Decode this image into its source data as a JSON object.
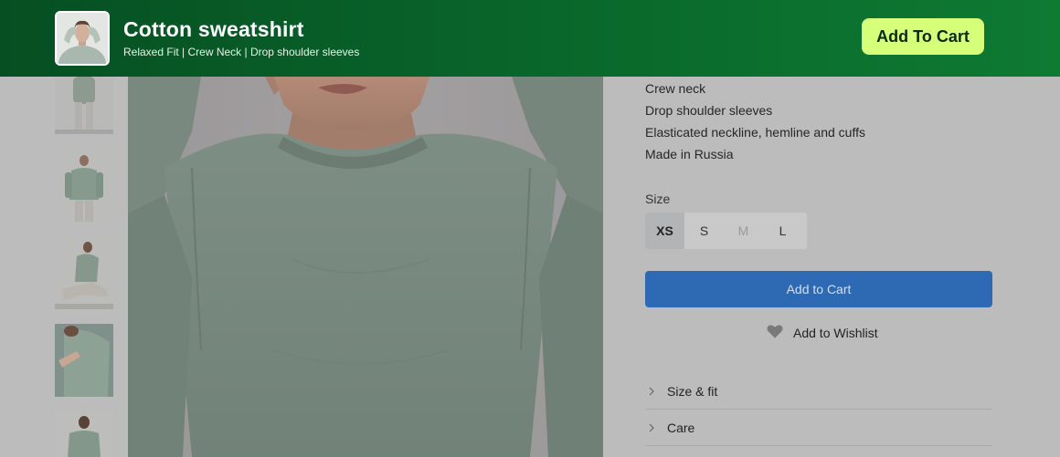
{
  "sticky_bar": {
    "product_name": "Cotton sweatshirt",
    "tagline": "Relaxed Fit | Crew Neck | Drop shoulder sleeves",
    "cta_label": "Add To Cart",
    "background": "#0a6a2c",
    "cta_color": "#d6ff7a"
  },
  "gallery": {
    "thumbnails": [
      {
        "name": "Model standing, full length"
      },
      {
        "name": "Model front view"
      },
      {
        "name": "Model seated on floor"
      },
      {
        "name": "Sleeve detail close-up"
      },
      {
        "name": "Model back view"
      }
    ],
    "main_image": "Model wearing sage green sweatshirt, close-up"
  },
  "details": {
    "features": [
      "Crew neck",
      "Drop shoulder sleeves",
      "Elasticated neckline, hemline and cuffs",
      "Made in Russia"
    ],
    "size_label": "Size",
    "sizes": [
      {
        "label": "XS",
        "state": "selected"
      },
      {
        "label": "S",
        "state": "available"
      },
      {
        "label": "M",
        "state": "unavailable"
      },
      {
        "label": "L",
        "state": "available"
      }
    ],
    "add_to_cart_label": "Add to Cart",
    "wishlist_label": "Add to Wishlist",
    "accordions": [
      {
        "label": "Size & fit"
      },
      {
        "label": "Care"
      }
    ],
    "accent_color": "#2e69b4"
  },
  "icons": {
    "wishlist": "heart-icon",
    "accordion": "chevron-right-icon"
  }
}
